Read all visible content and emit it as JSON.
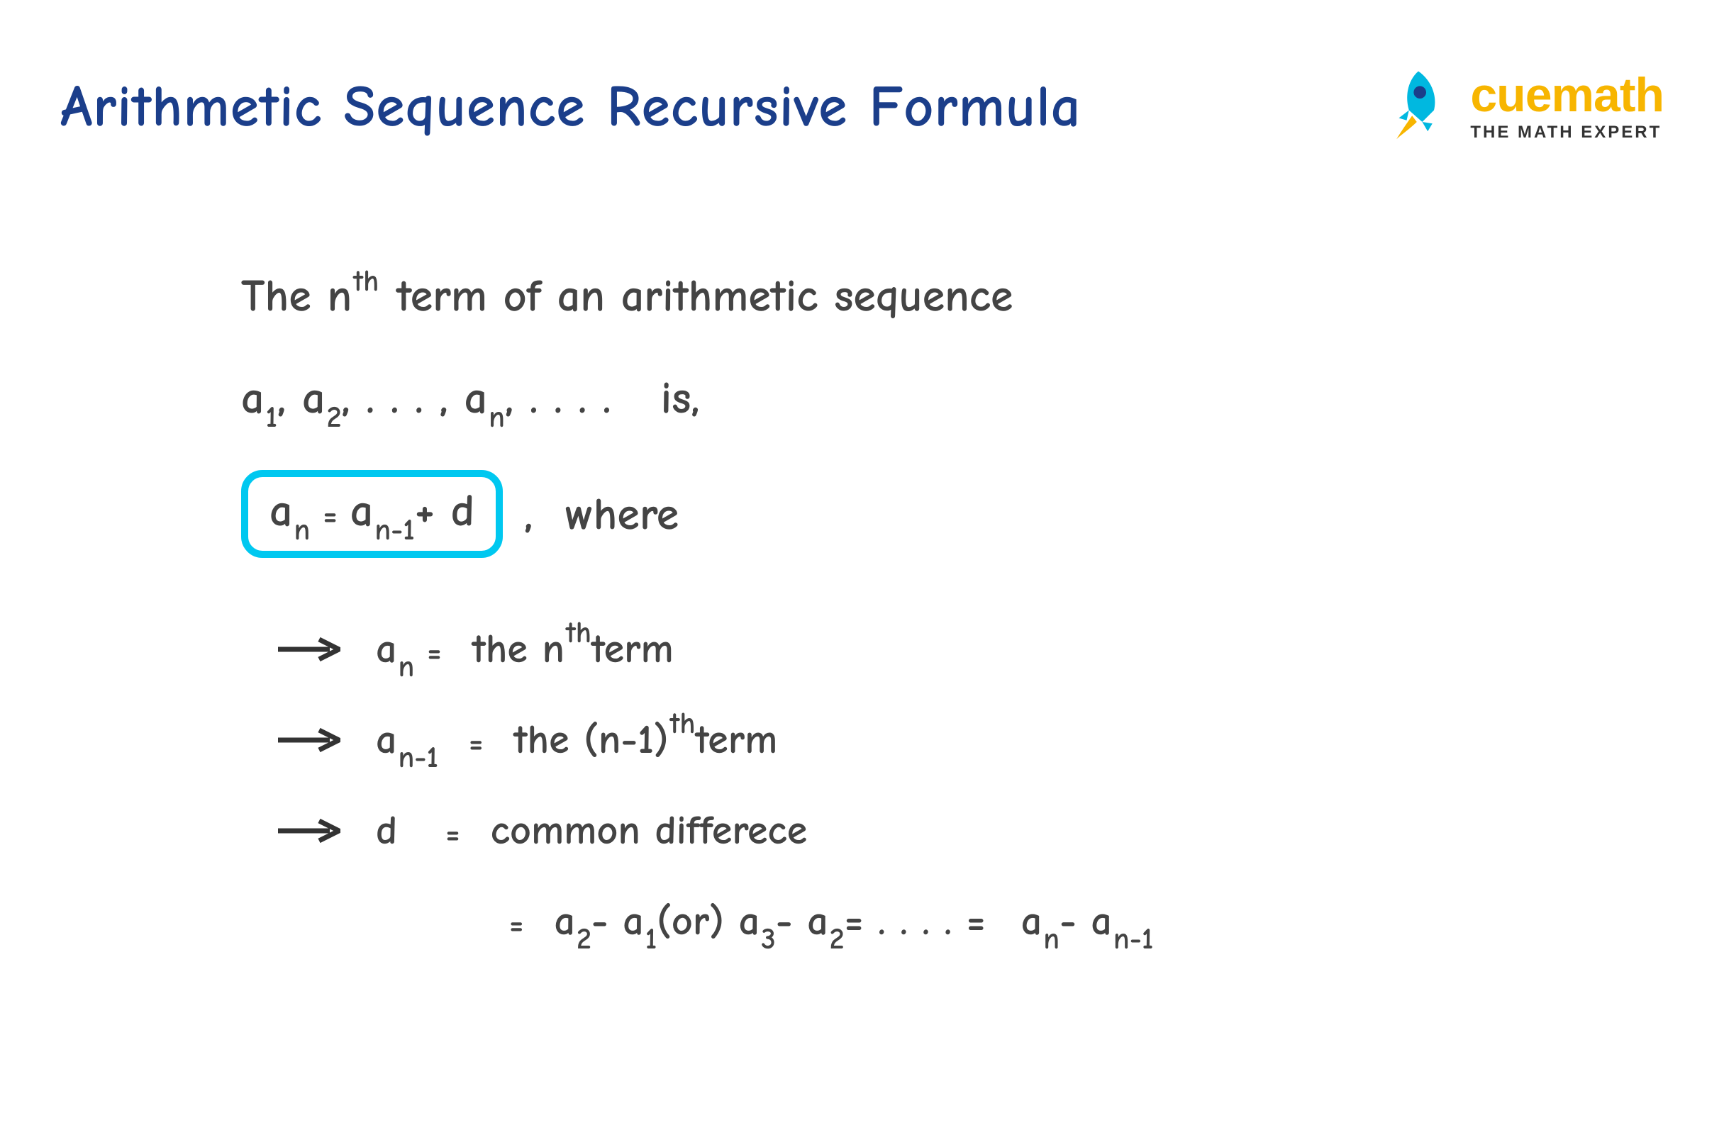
{
  "header": {
    "title": "Arithmetic Sequence Recursive Formula",
    "brand": "cuemath",
    "tagline": "THE MATH EXPERT"
  },
  "body": {
    "line1_a": "The n",
    "line1_sup": "th",
    "line1_b": " term of an arithmetic sequence",
    "seq_a": "a",
    "s1": "1",
    "sep1": " , a",
    "s2": "2",
    "sep2": " , . . . , a",
    "sn": "n",
    "sep3": " , . . . .",
    "is": "is,",
    "formula_a": "a",
    "formula_sub1": "n",
    "formula_eq": "=",
    "formula_b": "a",
    "formula_sub2": "n-1",
    "formula_plus": " + d",
    "where": ",  where",
    "b1_a": "a",
    "b1_sub": "n",
    "b1_eq": "=",
    "b1_txt1": "the n",
    "b1_sup": "th",
    "b1_txt2": " term",
    "b2_a": "a",
    "b2_sub": "n-1",
    "b2_eq": "=",
    "b2_txt1": "the (n-1)",
    "b2_sup": "th",
    "b2_txt2": " term",
    "b3_a": "d",
    "b3_eq": "=",
    "b3_txt": "common differece",
    "b4_eq": "=",
    "b4_a": "a",
    "b4_s2": "2",
    "b4_m1": " - a",
    "b4_s1": "1",
    "b4_or": " (or) a",
    "b4_s3": "3",
    "b4_m2": " - a",
    "b4_s2b": "2",
    "b4_eq2": " = . . . . =",
    "b4_an": "a",
    "b4_sn": "n",
    "b4_m3": " - a",
    "b4_sn1": "n-1"
  }
}
